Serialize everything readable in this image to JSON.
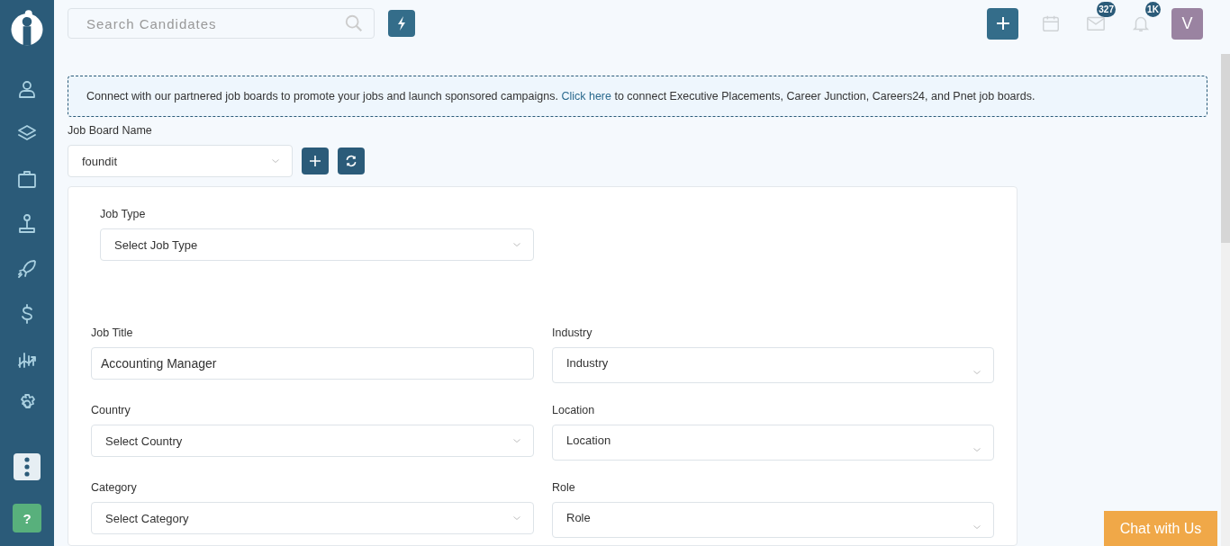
{
  "search": {
    "placeholder": "Search Candidates"
  },
  "header": {
    "mail_count": "327",
    "notification_count": "1K",
    "avatar": "V"
  },
  "sidebar": {
    "help": "?"
  },
  "banner": {
    "before": "Connect with our partnered job boards to promote your jobs and launch sponsored campaigns. ",
    "link": "Click here",
    "after": " to connect Executive Placements, Career Junction, Careers24, and Pnet job boards."
  },
  "job_board": {
    "label": "Job Board Name",
    "value": "foundit"
  },
  "job_type": {
    "label": "Job Type",
    "placeholder": "Select Job Type"
  },
  "fields": [
    {
      "label": "Job Title",
      "kind": "text",
      "value": "Accounting Manager"
    },
    {
      "label": "Industry",
      "kind": "select",
      "value": "Industry"
    },
    {
      "label": "Country",
      "kind": "select",
      "value": "Select Country"
    },
    {
      "label": "Location",
      "kind": "select",
      "value": "Location"
    },
    {
      "label": "Category",
      "kind": "select",
      "value": "Select Category"
    },
    {
      "label": "Role",
      "kind": "select",
      "value": "Role"
    }
  ],
  "chat": "Chat with Us"
}
